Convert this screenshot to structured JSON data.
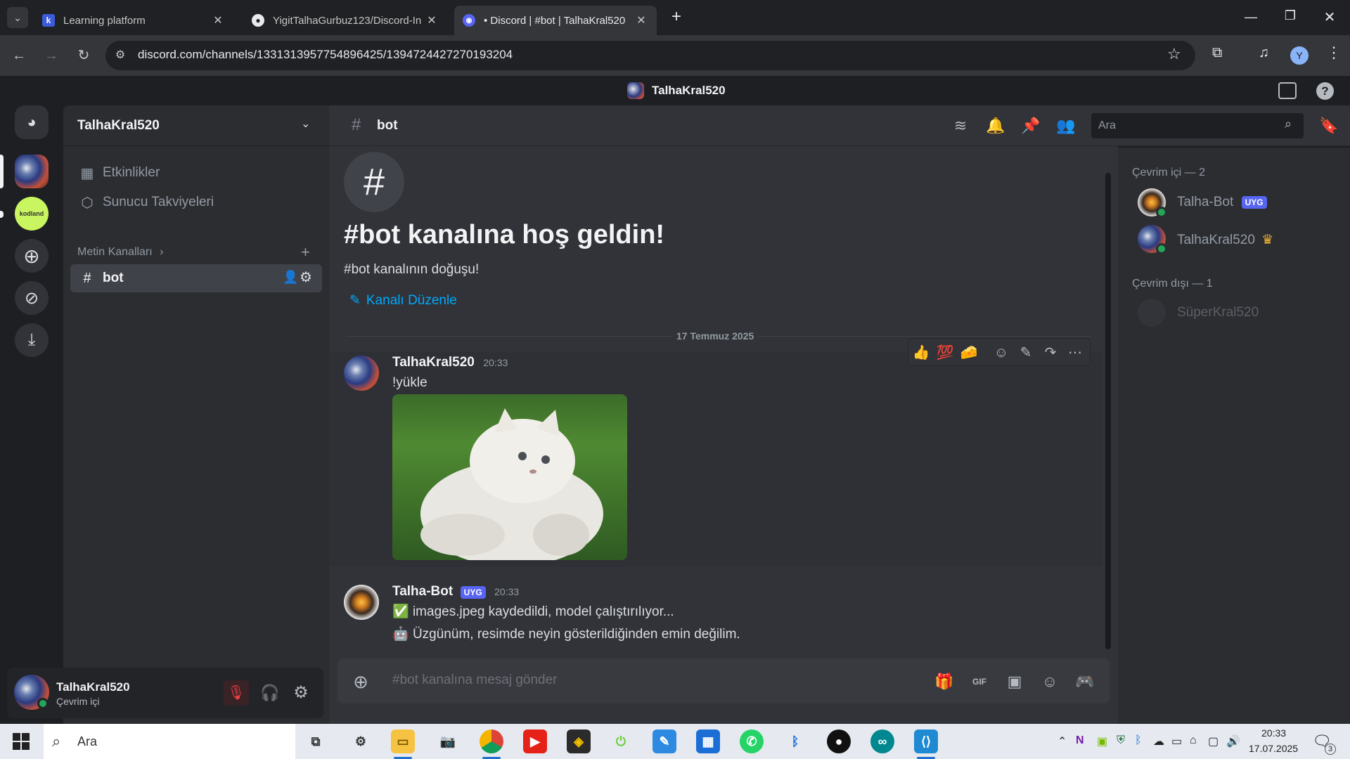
{
  "browser": {
    "tabs": [
      {
        "title": "Learning platform",
        "favicon": "k-logo-icon"
      },
      {
        "title": "YigitTalhaGurbuz123/Discord-In",
        "favicon": "github-icon"
      },
      {
        "title": "• Discord | #bot | TalhaKral520",
        "favicon": "discord-icon"
      }
    ],
    "url": "discord.com/channels/1331313957754896425/1394724427270193204",
    "profile_initial": "Y"
  },
  "topbar": {
    "server_name": "TalhaKral520"
  },
  "sidebar": {
    "server_title": "TalhaKral520",
    "items": [
      {
        "label": "Etkinlikler",
        "icon": "calendar-icon"
      },
      {
        "label": "Sunucu Takviyeleri",
        "icon": "boost-icon"
      }
    ],
    "category": "Metin Kanalları",
    "channels": [
      {
        "name": "bot"
      }
    ]
  },
  "guilds": {
    "kodland_label": "kodland"
  },
  "channel_header": {
    "name": "bot",
    "search_placeholder": "Ara"
  },
  "welcome": {
    "title": "#bot kanalına hoş geldin!",
    "subtitle": "#bot kanalının doğuşu!",
    "edit_label": "Kanalı Düzenle"
  },
  "divider_date": "17 Temmuz 2025",
  "messages": [
    {
      "author": "TalhaKral520",
      "time": "20:33",
      "text": "!yükle",
      "has_image": true
    },
    {
      "author": "Talha-Bot",
      "badge": "UYG",
      "time": "20:33",
      "lines": [
        "images.jpeg kaydedildi, model çalıştırılıyor...",
        "Üzgünüm, resimde neyin gösterildiğinden emin değilim."
      ],
      "line_emojis": [
        "✅",
        "🤖"
      ]
    }
  ],
  "hover_reactions": [
    "👍",
    "💯",
    "🧀"
  ],
  "composer": {
    "placeholder": "#bot kanalına mesaj gönder"
  },
  "members": {
    "online_header": "Çevrim içi — 2",
    "online": [
      {
        "name": "Talha-Bot",
        "badge": "UYG"
      },
      {
        "name": "TalhaKral520",
        "crown": "♛"
      }
    ],
    "offline_header": "Çevrim dışı — 1",
    "offline": [
      {
        "name": "SüperKral520"
      }
    ]
  },
  "user_panel": {
    "username": "TalhaKral520",
    "status": "Çevrim içi"
  },
  "taskbar": {
    "search_placeholder": "Ara",
    "time": "20:33",
    "date": "17.07.2025",
    "notification_count": "3"
  },
  "colors": {
    "accent": "#5865f2",
    "online": "#23a55a",
    "link": "#00a8fc"
  }
}
